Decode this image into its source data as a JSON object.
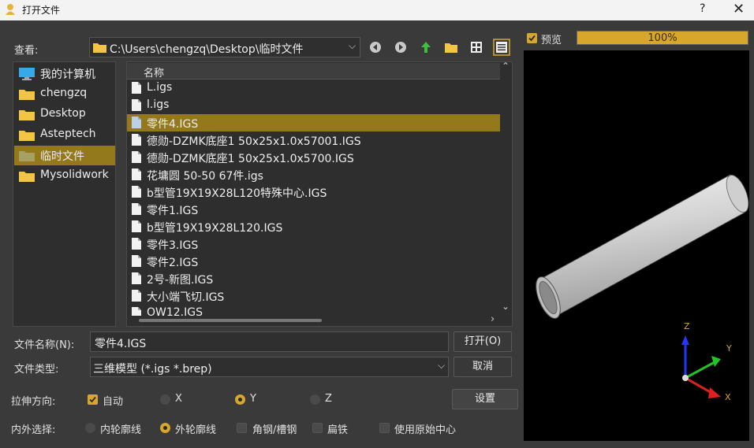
{
  "window": {
    "title": "打开文件",
    "help_glyph": "?",
    "close_glyph": "✕"
  },
  "lookin": {
    "label": "查看:",
    "path": "C:\\Users\\chengzq\\Desktop\\临时文件"
  },
  "preview": {
    "label": "预览",
    "checked": true,
    "progress_label": "100%",
    "progress": 1.0
  },
  "sidebar": {
    "items": [
      {
        "label": "我的计算机",
        "icon": "computer-icon"
      },
      {
        "label": "chengzq",
        "icon": "folder-icon"
      },
      {
        "label": "Desktop",
        "icon": "folder-icon"
      },
      {
        "label": "Asteptech",
        "icon": "folder-icon"
      },
      {
        "label": "临时文件",
        "icon": "folder-icon",
        "selected": true
      },
      {
        "label": "Mysolidwork",
        "icon": "folder-icon"
      }
    ]
  },
  "filelist": {
    "header": "名称",
    "items": [
      {
        "name": "L.igs"
      },
      {
        "name": "l.igs"
      },
      {
        "name": "零件4.IGS",
        "selected": true
      },
      {
        "name": "德勋-DZMK底座1 50x25x1.0x57001.IGS"
      },
      {
        "name": "德勋-DZMK底座1 50x25x1.0x5700.IGS"
      },
      {
        "name": "花墉圆 50-50  67件.igs"
      },
      {
        "name": "b型管19X19X28L120特殊中心.IGS"
      },
      {
        "name": "零件1.IGS"
      },
      {
        "name": "b型管19X19X28L120.IGS"
      },
      {
        "name": "零件3.IGS"
      },
      {
        "name": "零件2.IGS"
      },
      {
        "name": "2号-新图.IGS"
      },
      {
        "name": "大小端飞切.IGS"
      },
      {
        "name": "OW12.IGS"
      }
    ]
  },
  "filename": {
    "label": "文件名称(N):",
    "value": "零件4.IGS",
    "open_button": "打开(O)"
  },
  "filetype": {
    "label": "文件类型:",
    "value": "三维模型 (*.igs *.brep)",
    "cancel_button": "取消"
  },
  "stretch": {
    "label": "拉伸方向:",
    "auto_label": "自动",
    "x_label": "X",
    "y_label": "Y",
    "z_label": "Z",
    "selected": "Y",
    "settings_button": "设置"
  },
  "contour": {
    "label": "内外选择:",
    "inner_label": "内轮廓线",
    "outer_label": "外轮廓线",
    "angle_label": "角钢/槽钢",
    "flat_label": "扁铁",
    "origin_label": "使用原始中心",
    "selected": "outer"
  },
  "axes": {
    "x": "X",
    "y": "Y",
    "z": "Z"
  },
  "colors": {
    "accent": "#d7a72b",
    "selection": "#93781c",
    "progress": "#d7a72b"
  }
}
